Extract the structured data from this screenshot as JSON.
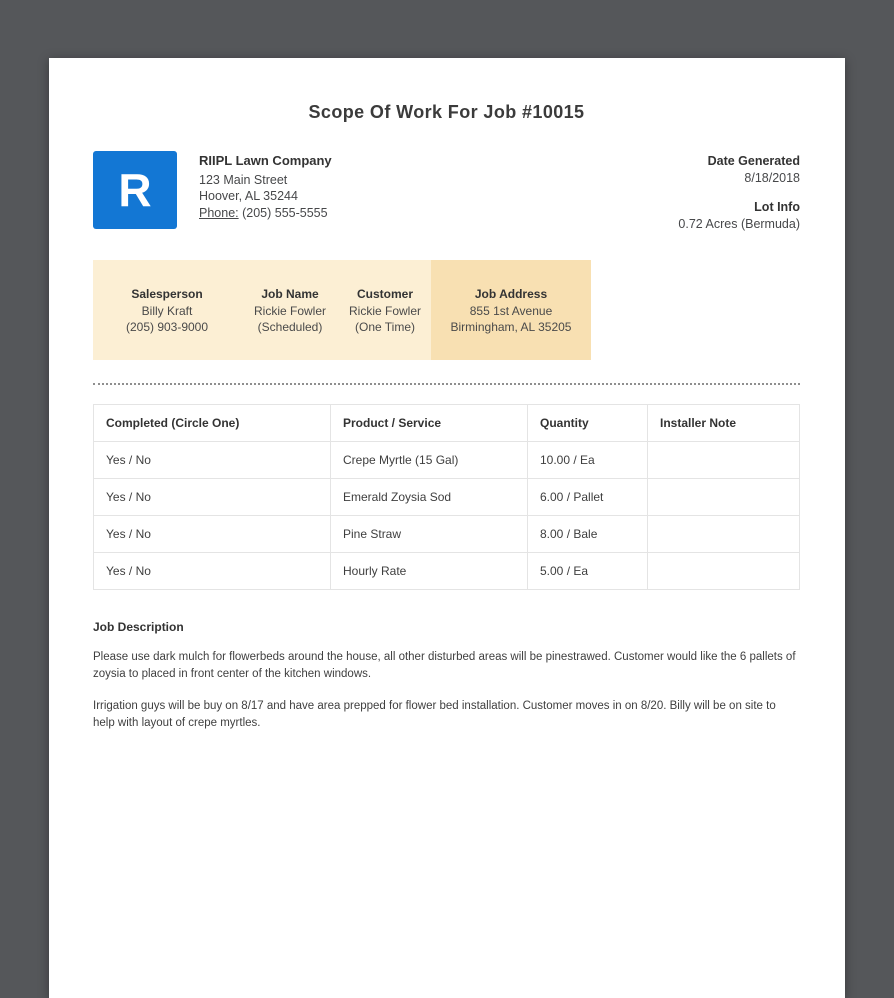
{
  "page": {
    "title": "Scope Of Work For Job #10015"
  },
  "company": {
    "logo_letter": "R",
    "name": "RIIPL Lawn Company",
    "address_line1": "123 Main Street",
    "address_line2": "Hoover, AL 35244",
    "phone_label": "Phone:",
    "phone_value": "(205) 555-5555"
  },
  "meta": {
    "date_generated_label": "Date Generated",
    "date_generated_value": "8/18/2018",
    "lot_info_label": "Lot Info",
    "lot_info_value": "0.72 Acres (Bermuda)"
  },
  "info_bar": {
    "columns": [
      {
        "label": "Salesperson",
        "line1": "Billy Kraft",
        "line2": "(205) 903-9000"
      },
      {
        "label": "Job Name",
        "line1": "Rickie Fowler",
        "line2": "(Scheduled)"
      },
      {
        "label": "Customer",
        "line1": "Rickie Fowler",
        "line2": "(One Time)"
      },
      {
        "label": "Job Address",
        "line1": "855 1st Avenue",
        "line2": "Birmingham, AL 35205"
      }
    ]
  },
  "work_table": {
    "headers": [
      "Completed (Circle One)",
      "Product / Service",
      "Quantity",
      "Installer Note"
    ],
    "rows": [
      [
        "Yes / No",
        "Crepe Myrtle (15 Gal)",
        "10.00 / Ea",
        ""
      ],
      [
        "Yes / No",
        "Emerald Zoysia Sod",
        "6.00 / Pallet",
        ""
      ],
      [
        "Yes / No",
        "Pine Straw",
        "8.00 / Bale",
        ""
      ],
      [
        "Yes / No",
        "Hourly Rate",
        "5.00 / Ea",
        ""
      ]
    ]
  },
  "job_description": {
    "heading": "Job Description",
    "paragraphs": [
      "Please use dark mulch for flowerbeds around the house, all other disturbed areas will be pinestrawed. Customer would like the 6 pallets of zoysia to placed in front center of the kitchen windows.",
      "Irrigation guys will be buy on 8/17 and have area prepped for flower bed installation. Customer moves in on 8/20. Billy will be on site to help with layout of crepe myrtles."
    ]
  },
  "colors": {
    "viewer_background": "#55575a",
    "brand_blue": "#1377d4",
    "info_bar_background": "#fcefd4",
    "info_bar_highlight_background": "#f8e0b2"
  }
}
